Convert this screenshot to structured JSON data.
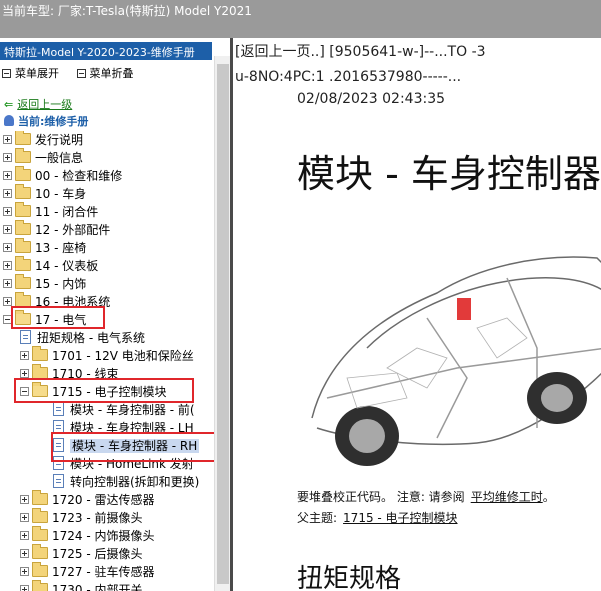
{
  "window": {
    "title": "当前车型:  厂家:T-Tesla(特斯拉) Model Y2021"
  },
  "sidebar": {
    "manual_title": "特斯拉-Model Y-2020-2023-维修手册",
    "menu_expand": "菜单展开",
    "menu_collapse": "菜单折叠",
    "back_link": "返回上一级",
    "current_label": "当前:维修手册",
    "tree": [
      {
        "label": "发行说明",
        "kind": "folder",
        "expander": "plus",
        "level": 0
      },
      {
        "label": "一般信息",
        "kind": "folder",
        "expander": "plus",
        "level": 0
      },
      {
        "label": "00 - 检查和维修",
        "kind": "folder",
        "expander": "plus",
        "level": 0
      },
      {
        "label": "10 - 车身",
        "kind": "folder",
        "expander": "plus",
        "level": 0
      },
      {
        "label": "11 - 闭合件",
        "kind": "folder",
        "expander": "plus",
        "level": 0
      },
      {
        "label": "12 - 外部配件",
        "kind": "folder",
        "expander": "plus",
        "level": 0
      },
      {
        "label": "13 - 座椅",
        "kind": "folder",
        "expander": "plus",
        "level": 0
      },
      {
        "label": "14 - 仪表板",
        "kind": "folder",
        "expander": "plus",
        "level": 0
      },
      {
        "label": "15 - 内饰",
        "kind": "folder",
        "expander": "plus",
        "level": 0
      },
      {
        "label": "16 - 电池系统",
        "kind": "folder",
        "expander": "plus",
        "level": 0
      },
      {
        "label": "17 - 电气",
        "kind": "folder-open",
        "expander": "minus",
        "level": 0
      },
      {
        "label": "扭矩规格 - 电气系统",
        "kind": "doc",
        "expander": "none",
        "level": 1
      },
      {
        "label": "1701 - 12V 电池和保险丝",
        "kind": "folder",
        "expander": "plus",
        "level": 1
      },
      {
        "label": "1710 - 线束",
        "kind": "folder",
        "expander": "plus",
        "level": 1
      },
      {
        "label": "1715 - 电子控制模块",
        "kind": "folder-open",
        "expander": "minus",
        "level": 1
      },
      {
        "label": "模块 - 车身控制器 - 前(",
        "kind": "doc",
        "expander": "none",
        "level": 2
      },
      {
        "label": "模块 - 车身控制器 - LH",
        "kind": "doc",
        "expander": "none",
        "level": 2
      },
      {
        "label": "模块 - 车身控制器 - RH",
        "kind": "doc",
        "expander": "none",
        "level": 2,
        "selected": true
      },
      {
        "label": "模块 - HomeLink 发射",
        "kind": "doc",
        "expander": "none",
        "level": 2
      },
      {
        "label": "转向控制器(拆卸和更换)",
        "kind": "doc",
        "expander": "none",
        "level": 2
      },
      {
        "label": "1720 - 雷达传感器",
        "kind": "folder",
        "expander": "plus",
        "level": 1
      },
      {
        "label": "1723 - 前摄像头",
        "kind": "folder",
        "expander": "plus",
        "level": 1
      },
      {
        "label": "1724 - 内饰摄像头",
        "kind": "folder",
        "expander": "plus",
        "level": 1
      },
      {
        "label": "1725 - 后摄像头",
        "kind": "folder",
        "expander": "plus",
        "level": 1
      },
      {
        "label": "1727 - 驻车传感器",
        "kind": "folder",
        "expander": "plus",
        "level": 1
      },
      {
        "label": "1730 - 内部开关",
        "kind": "folder",
        "expander": "plus",
        "level": 1
      }
    ]
  },
  "content": {
    "nav_line": "[返回上一页..] [9505641-w-]--...TO -3",
    "code_line": "u-8NO:4PC:1 .2016537980-----...",
    "date": "02/08/2023 02:43:35",
    "title": "模块 - 车身控制器",
    "correction_prefix": "要堆叠校正代码。 注意: 请参阅",
    "correction_link": "平均维修工时",
    "correction_suffix": "。",
    "parent_label": "父主题:",
    "parent_link": "1715 - 电子控制模块",
    "section_title": "扭矩规格"
  }
}
